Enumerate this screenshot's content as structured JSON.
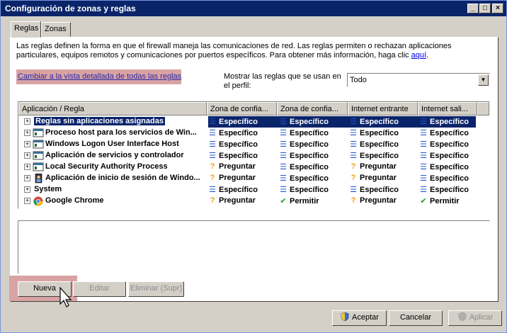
{
  "window": {
    "title": "Configuración de zonas y reglas",
    "controls": {
      "minimize": "_",
      "maximize": "□",
      "close": "×"
    }
  },
  "tabs": [
    {
      "label": "Reglas",
      "active": true
    },
    {
      "label": "Zonas",
      "active": false
    }
  ],
  "description": {
    "text": "Las reglas definen la forma en que el firewall maneja las comunicaciones de red. Las reglas permiten o rechazan aplicaciones particulares, equipos remotos y comunicaciones por puertos específicos. Para obtener más información, haga clic ",
    "link": "aquí",
    "end": "."
  },
  "switch_view_link": "Cambiar a la vista detallada de todas las reglas",
  "profile": {
    "label": "Mostrar las reglas que se usan en el perfil:",
    "selected": "Todo"
  },
  "columns": [
    "Aplicación / Regla",
    "Zona de confia...",
    "Zona de confia...",
    "Internet entrante",
    "Internet sali..."
  ],
  "rows": [
    {
      "name": "Reglas sin aplicaciones asignadas",
      "icon": "none",
      "selected": true,
      "z1": "Específico",
      "z2": "Específico",
      "z3": "Específico",
      "z4": "Específico"
    },
    {
      "name": "Proceso host para los servicios de Win...",
      "icon": "app-window-icon",
      "selected": false,
      "z1": "Específico",
      "z2": "Específico",
      "z3": "Específico",
      "z4": "Específico"
    },
    {
      "name": "Windows Logon User Interface Host",
      "icon": "app-window-icon",
      "selected": false,
      "z1": "Específico",
      "z2": "Específico",
      "z3": "Específico",
      "z4": "Específico"
    },
    {
      "name": "Aplicación de servicios y controlador",
      "icon": "app-window-icon",
      "selected": false,
      "z1": "Específico",
      "z2": "Específico",
      "z3": "Específico",
      "z4": "Específico"
    },
    {
      "name": "Local Security Authority Process",
      "icon": "app-window-icon",
      "selected": false,
      "z1": "Preguntar",
      "z2": "Específico",
      "z3": "Preguntar",
      "z4": "Específico"
    },
    {
      "name": "Aplicación de inicio de sesión de Windo...",
      "icon": "logon-app-icon",
      "selected": false,
      "z1": "Preguntar",
      "z2": "Específico",
      "z3": "Preguntar",
      "z4": "Específico"
    },
    {
      "name": "System",
      "icon": "none",
      "selected": false,
      "z1": "Específico",
      "z2": "Específico",
      "z3": "Específico",
      "z4": "Específico"
    },
    {
      "name": "Google Chrome",
      "icon": "chrome-icon",
      "selected": false,
      "z1": "Preguntar",
      "z2": "Permitir",
      "z3": "Preguntar",
      "z4": "Permitir"
    }
  ],
  "buttons": {
    "new": "Nueva",
    "edit": "Editar",
    "delete": "Eliminar (Supr)",
    "accept": "Aceptar",
    "cancel": "Cancelar",
    "apply": "Aplicar"
  },
  "colors": {
    "selection": "#0a246a",
    "highlight": "#d9a3a3",
    "specific": "#2255cc",
    "ask": "#f39a1a",
    "allow": "#1e9a1e"
  }
}
